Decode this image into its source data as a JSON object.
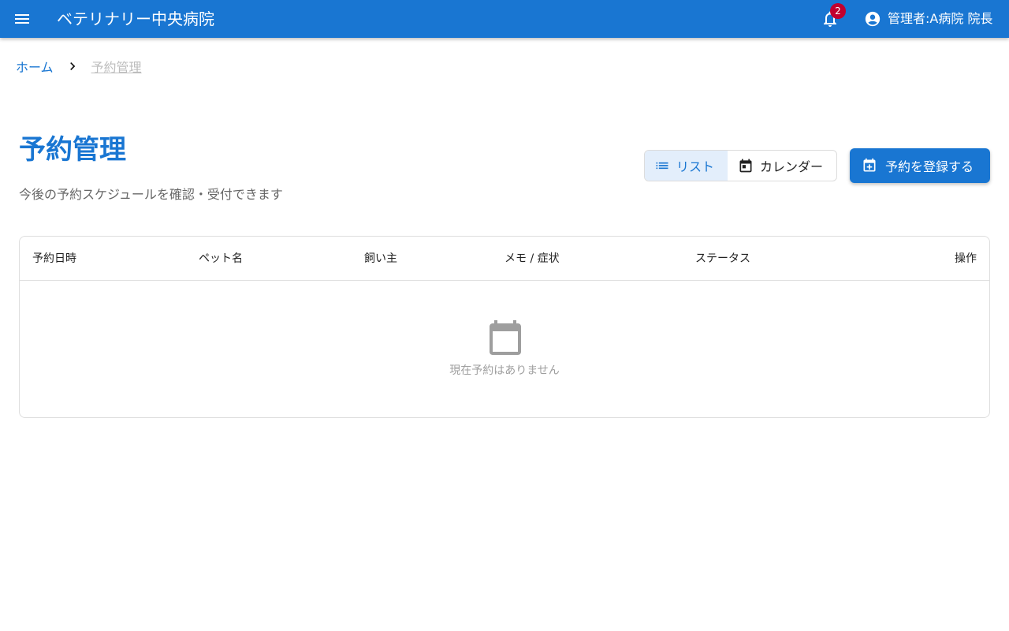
{
  "appbar": {
    "menu_icon": "menu-icon",
    "title": "ベテリナリー中央病院",
    "notifications": {
      "icon": "bell-icon",
      "count": "2"
    },
    "user": {
      "icon": "account-circle-icon",
      "name": "管理者:A病院 院長"
    }
  },
  "breadcrumb": {
    "home": "ホーム",
    "separator_icon": "chevron-right-icon",
    "current": "予約管理"
  },
  "page": {
    "title": "予約管理",
    "subtitle": "今後の予約スケジュールを確認・受付できます"
  },
  "view_toggle": {
    "selected": "list",
    "list": {
      "icon": "list-icon",
      "label": "リスト"
    },
    "calendar": {
      "icon": "calendar-icon",
      "label": "カレンダー"
    }
  },
  "register_button": {
    "icon": "calendar-add-icon",
    "label": "予約を登録する"
  },
  "table": {
    "columns": [
      "予約日時",
      "ペット名",
      "飼い主",
      "メモ / 症状",
      "ステータス",
      "操作"
    ],
    "rows": [],
    "empty": {
      "icon": "calendar-icon",
      "message": "現在予約はありません"
    }
  },
  "colors": {
    "primary": "#1976d2",
    "badge": "#c2002f",
    "toggle_selected_bg": "#e3eefb"
  }
}
